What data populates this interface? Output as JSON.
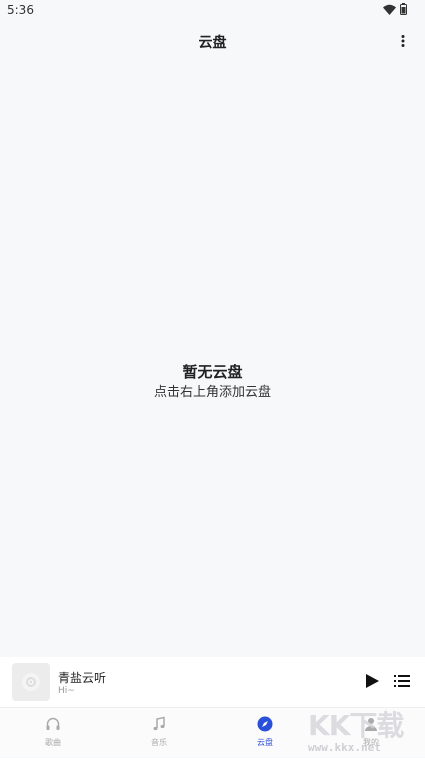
{
  "status_bar": {
    "time": "5:36"
  },
  "header": {
    "title": "云盘"
  },
  "empty_state": {
    "title": "暂无云盘",
    "subtitle": "点击右上角添加云盘"
  },
  "player": {
    "song_title": "青盐云听",
    "song_subtitle": "Hi~"
  },
  "tabs": [
    {
      "label": "歌曲",
      "icon": "headphones-icon",
      "active": false
    },
    {
      "label": "音乐",
      "icon": "music-note-icon",
      "active": false
    },
    {
      "label": "云盘",
      "icon": "compass-icon",
      "active": true
    },
    {
      "label": "我的",
      "icon": "person-icon",
      "active": false
    }
  ],
  "watermark": {
    "logo": "KK下载",
    "url": "www.kkx.net"
  },
  "colors": {
    "accent": "#2a4fd8",
    "background": "#f7f8fa",
    "tab_inactive": "#aaaaaa"
  }
}
